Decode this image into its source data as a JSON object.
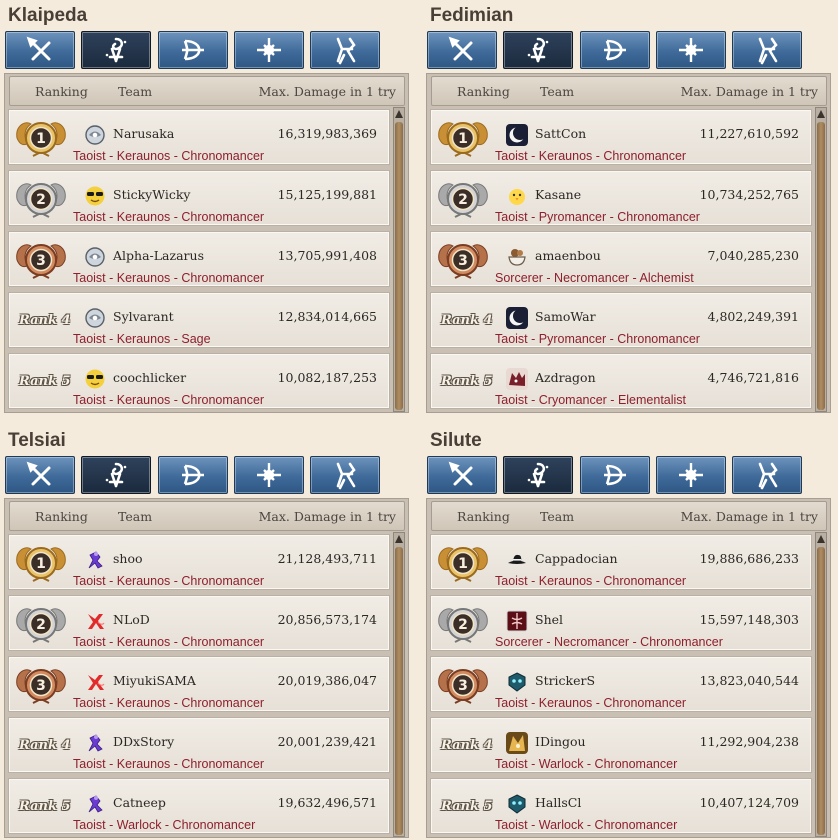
{
  "colors": {
    "tab_blue": "#3f6a99",
    "tab_active": "#1b2a3d",
    "class_text": "#8e1f2c",
    "gold": "#d8a849",
    "silver": "#b5b5b5",
    "bronze": "#b5714a"
  },
  "tab_icons": [
    "sword-icon",
    "wizard-icon",
    "bow-icon",
    "cross-icon",
    "scout-icon"
  ],
  "headers": {
    "ranking": "Ranking",
    "team": "Team",
    "damage": "Max. Damage in 1 try"
  },
  "panels": [
    {
      "server": "Klaipeda",
      "rows": [
        {
          "medal": "1",
          "avatar": "mask",
          "name": "Narusaka",
          "damage": "16,319,983,369",
          "classes": "Taoist - Keraunos - Chronomancer"
        },
        {
          "medal": "2",
          "avatar": "sunglasses",
          "name": "StickyWicky",
          "damage": "15,125,199,881",
          "classes": "Taoist - Keraunos - Chronomancer"
        },
        {
          "medal": "3",
          "avatar": "mask",
          "name": "Alpha-Lazarus",
          "damage": "13,705,991,408",
          "classes": "Taoist - Keraunos - Chronomancer"
        },
        {
          "rank": "Rank 4",
          "avatar": "mask",
          "name": "Sylvarant",
          "damage": "12,834,014,665",
          "classes": "Taoist - Keraunos - Sage"
        },
        {
          "rank": "Rank 5",
          "avatar": "sunglasses",
          "name": "coochlicker",
          "damage": "10,082,187,253",
          "classes": "Taoist - Keraunos - Chronomancer"
        }
      ]
    },
    {
      "server": "Fedimian",
      "rows": [
        {
          "medal": "1",
          "avatar": "moon",
          "name": "SattCon",
          "damage": "11,227,610,592",
          "classes": "Taoist - Keraunos - Chronomancer"
        },
        {
          "medal": "2",
          "avatar": "chick",
          "name": "Kasane",
          "damage": "10,734,252,765",
          "classes": "Taoist - Pyromancer - Chronomancer"
        },
        {
          "medal": "3",
          "avatar": "bowl",
          "name": "amaenbou",
          "damage": "7,040,285,230",
          "classes": "Sorcerer - Necromancer - Alchemist"
        },
        {
          "rank": "Rank 4",
          "avatar": "moon",
          "name": "SamoWar",
          "damage": "4,802,249,391",
          "classes": "Taoist - Pyromancer - Chronomancer"
        },
        {
          "rank": "Rank 5",
          "avatar": "beast",
          "name": "Azdragon",
          "damage": "4,746,721,816",
          "classes": "Taoist - Cryomancer - Elementalist"
        }
      ]
    },
    {
      "server": "Telsiai",
      "rows": [
        {
          "medal": "1",
          "avatar": "purple",
          "name": "shoo",
          "damage": "21,128,493,711",
          "classes": "Taoist - Keraunos - Chronomancer"
        },
        {
          "medal": "2",
          "avatar": "redk",
          "name": "NLoD",
          "damage": "20,856,573,174",
          "classes": "Taoist - Keraunos - Chronomancer"
        },
        {
          "medal": "3",
          "avatar": "redk",
          "name": "MiyukiSAMA",
          "damage": "20,019,386,047",
          "classes": "Taoist - Keraunos - Chronomancer"
        },
        {
          "rank": "Rank 4",
          "avatar": "purple",
          "name": "DDxStory",
          "damage": "20,001,239,421",
          "classes": "Taoist - Keraunos - Chronomancer"
        },
        {
          "rank": "Rank 5",
          "avatar": "purple",
          "name": "Catneep",
          "damage": "19,632,496,571",
          "classes": "Taoist - Warlock - Chronomancer"
        }
      ]
    },
    {
      "server": "Silute",
      "rows": [
        {
          "medal": "1",
          "avatar": "hat",
          "name": "Cappadocian",
          "damage": "19,886,686,233",
          "classes": "Taoist - Keraunos - Chronomancer"
        },
        {
          "medal": "2",
          "avatar": "redbox",
          "name": "Shel",
          "damage": "15,597,148,303",
          "classes": "Sorcerer - Necromancer - Chronomancer"
        },
        {
          "medal": "3",
          "avatar": "teal",
          "name": "StrickerS",
          "damage": "13,823,040,544",
          "classes": "Taoist - Keraunos - Chronomancer"
        },
        {
          "rank": "Rank 4",
          "avatar": "gold",
          "name": "IDingou",
          "damage": "11,292,904,238",
          "classes": "Taoist - Warlock - Chronomancer"
        },
        {
          "rank": "Rank 5",
          "avatar": "teal",
          "name": "HallsCl",
          "damage": "10,407,124,709",
          "classes": "Taoist - Warlock - Chronomancer"
        }
      ]
    }
  ]
}
